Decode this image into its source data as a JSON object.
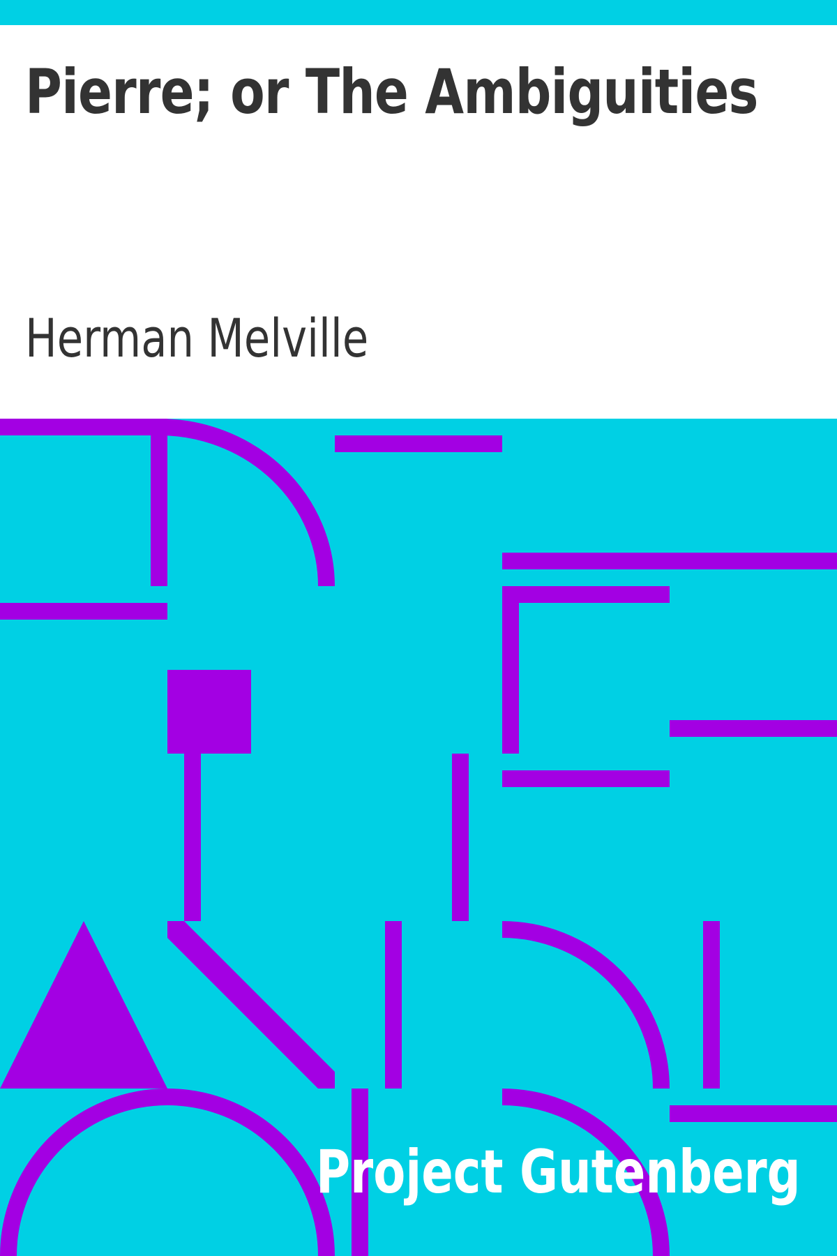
{
  "cover": {
    "title": "Pierre; or The Ambiguities",
    "author": "Herman Melville",
    "publisher": "Project Gutenberg"
  },
  "colors": {
    "background_accent": "#00d0e4",
    "pattern": "#a300e3",
    "title_text": "#333333",
    "publisher_text": "#ffffff"
  }
}
